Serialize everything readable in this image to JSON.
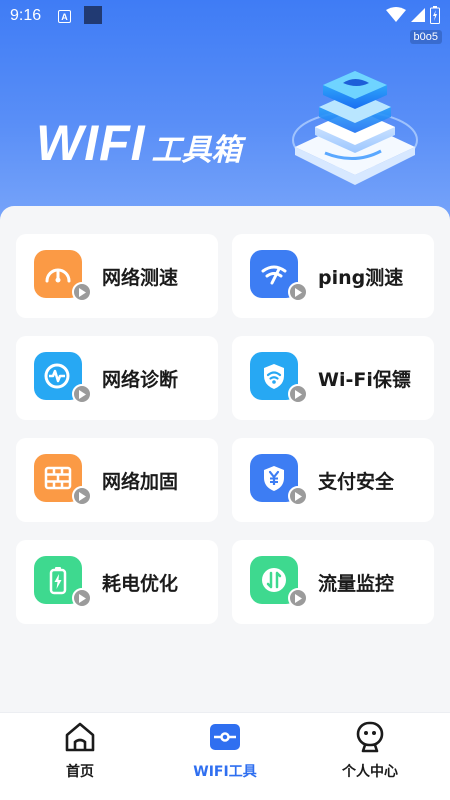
{
  "status_bar": {
    "time": "9:16",
    "notif_letter": "A",
    "build_tag": "b0o5"
  },
  "header": {
    "brand_latin": "WIFI",
    "brand_cn": "工具箱"
  },
  "tools": [
    {
      "label": "网络测速",
      "icon": "speedometer-icon",
      "color": "#fb9a45"
    },
    {
      "label": "ping测速",
      "icon": "signal-speed-icon",
      "color": "#3d7df3"
    },
    {
      "label": "网络诊断",
      "icon": "pulse-diagnosis-icon",
      "color": "#27a8f3"
    },
    {
      "label": "Wi-Fi保镖",
      "icon": "wifi-shield-icon",
      "color": "#27a8f3"
    },
    {
      "label": "网络加固",
      "icon": "firewall-icon",
      "color": "#fb9a45"
    },
    {
      "label": "支付安全",
      "icon": "payment-shield-icon",
      "color": "#3d7df3"
    },
    {
      "label": "耗电优化",
      "icon": "battery-icon",
      "color": "#3ed98f"
    },
    {
      "label": "流量监控",
      "icon": "traffic-monitor-icon",
      "color": "#3ed98f"
    }
  ],
  "bottom_nav": [
    {
      "label": "首页",
      "icon": "home-icon",
      "active": false
    },
    {
      "label": "WIFI工具",
      "icon": "wifi-tools-icon",
      "active": true
    },
    {
      "label": "个人中心",
      "icon": "profile-icon",
      "active": false
    }
  ],
  "colors": {
    "accent": "#2f6ff0",
    "header_top": "#3f7cf5",
    "play_badge": "#9b9b9b"
  }
}
